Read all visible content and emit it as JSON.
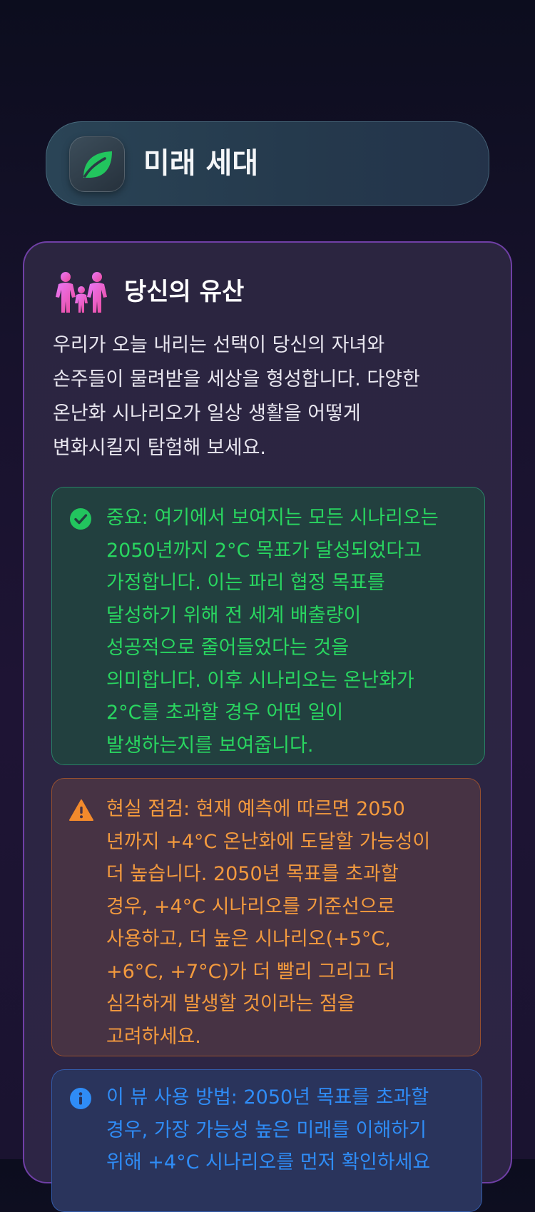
{
  "header": {
    "logo_icon": "leaf-icon",
    "title": "미래 세대",
    "accent_color": "#22c55e"
  },
  "legacy_card": {
    "icon": "family-icon",
    "title": "당신의 유산",
    "description_lines": [
      "우리가 오늘 내리는 선택이 당신의 자녀와",
      "손주들이 물려받을 세상을 형성합니다. 다양한",
      "온난화 시나리오가 일상 생활을 어떻게",
      "변화시킬지 탐험해 보세요."
    ]
  },
  "notices": {
    "important": {
      "icon": "check-circle-icon",
      "color": "#29d660",
      "lines": [
        "중요: 여기에서 보여지는 모든 시나리오는",
        "2050년까지 2°C 목표가 달성되었다고",
        "가정합니다. 이는 파리 협정 목표를",
        "달성하기 위해 전 세계 배출량이",
        "성공적으로 줄어들었다는 것을",
        "의미합니다. 이후 시나리오는 온난화가",
        "2°C를 초과할 경우 어떤 일이",
        "발생하는지를 보여줍니다."
      ]
    },
    "reality_check": {
      "icon": "warning-icon",
      "color": "#f39a3e",
      "lines": [
        "현실 점검: 현재 예측에 따르면 2050",
        "년까지 +4°C 온난화에 도달할 가능성이",
        "더 높습니다. 2050년 목표를 초과할",
        "경우, +4°C 시나리오를 기준선으로",
        "사용하고, 더 높은 시나리오(+5°C,",
        "+6°C, +7°C)가 더 빨리 그리고 더",
        "심각하게 발생할 것이라는 점을",
        "고려하세요."
      ]
    },
    "how_to_use": {
      "icon": "info-icon",
      "color": "#2f8cf6",
      "lines": [
        "이 뷰 사용 방법: 2050년 목표를 초과할",
        "경우, 가장 가능성 높은 미래를 이해하기",
        "위해 +4°C 시나리오를 먼저 확인하세요"
      ]
    }
  }
}
